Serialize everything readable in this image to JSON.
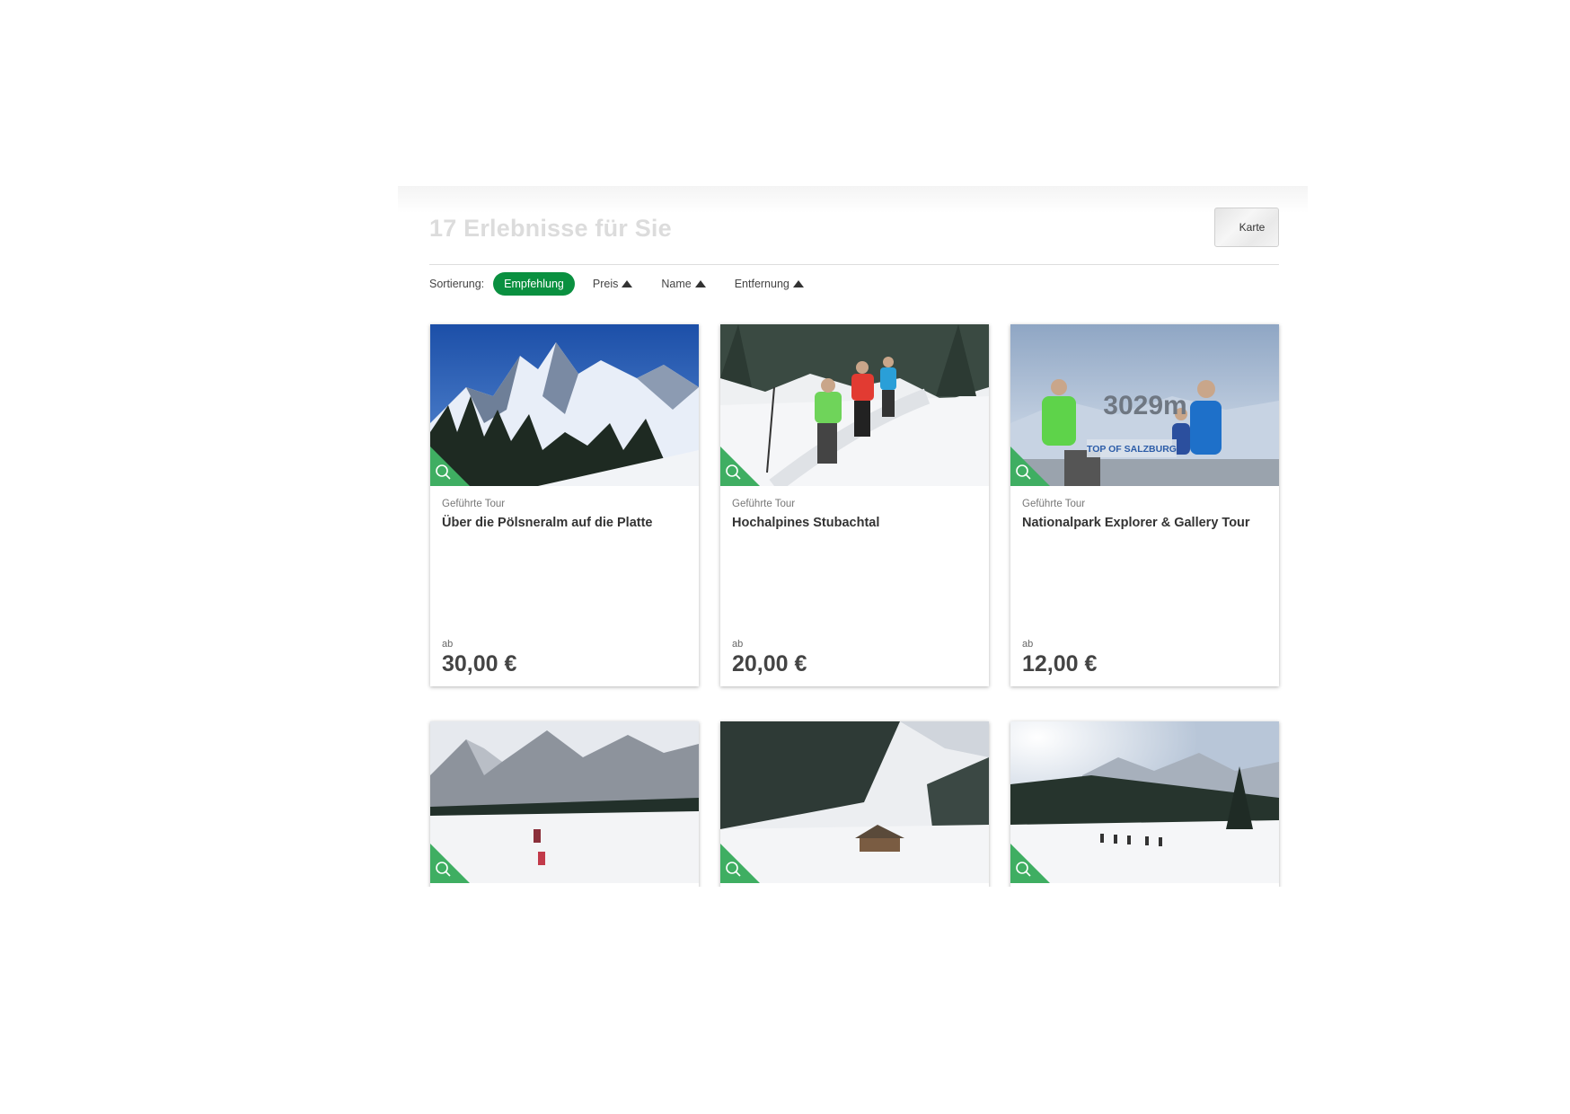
{
  "header": {
    "title": "17 Erlebnisse für Sie",
    "map_button": "Karte"
  },
  "sorting": {
    "label": "Sortierung:",
    "options": [
      {
        "label": "Empfehlung",
        "active": true
      },
      {
        "label": "Preis",
        "arrow": "up"
      },
      {
        "label": "Name",
        "arrow": "up"
      },
      {
        "label": "Entfernung",
        "arrow": "up"
      }
    ]
  },
  "colors": {
    "accent": "#0a9040",
    "corner": "#3fae62"
  },
  "cards": [
    {
      "category": "Geführte Tour",
      "title": "Über die Pölsneralm auf die Platte",
      "price_prefix": "ab",
      "price": "30,00 €",
      "image": "mountain-peaks-forest",
      "icon": "magnifier-icon"
    },
    {
      "category": "Geführte Tour",
      "title": "Hochalpines Stubachtal",
      "price_prefix": "ab",
      "price": "20,00 €",
      "image": "snowshoe-hikers",
      "icon": "magnifier-icon"
    },
    {
      "category": "Geführte Tour",
      "title": "Nationalpark Explorer & Gallery Tour",
      "price_prefix": "ab",
      "price": "12,00 €",
      "image": "summit-platform-3029m",
      "sign_text": "3029m",
      "sign_subtext": "TOP OF SALZBURG",
      "icon": "magnifier-icon"
    },
    {
      "image": "valley-hikers",
      "icon": "magnifier-icon"
    },
    {
      "image": "alpine-hut-forest",
      "icon": "magnifier-icon"
    },
    {
      "image": "sunny-snow-field-group",
      "icon": "magnifier-icon"
    }
  ]
}
